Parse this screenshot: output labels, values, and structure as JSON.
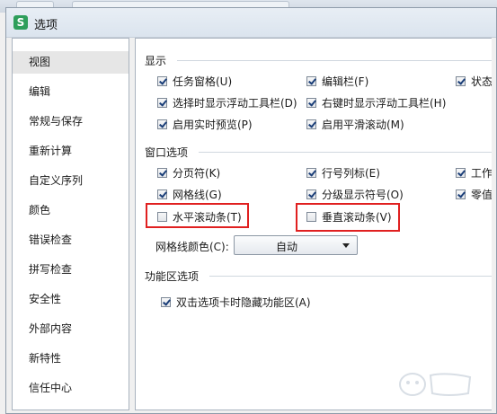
{
  "dialog": {
    "title": "选项",
    "app_icon_letter": "S"
  },
  "sidebar": {
    "items": [
      {
        "label": "视图",
        "selected": true
      },
      {
        "label": "编辑"
      },
      {
        "label": "常规与保存"
      },
      {
        "label": "重新计算"
      },
      {
        "label": "自定义序列"
      },
      {
        "label": "颜色"
      },
      {
        "label": "错误检查"
      },
      {
        "label": "拼写检查"
      },
      {
        "label": "安全性"
      },
      {
        "label": "外部内容"
      },
      {
        "label": "新特性"
      },
      {
        "label": "信任中心"
      }
    ]
  },
  "display": {
    "title": "显示",
    "options": [
      {
        "label": "任务窗格(U)",
        "checked": true
      },
      {
        "label": "编辑栏(F)",
        "checked": true
      },
      {
        "label": "状态栏",
        "checked": true
      },
      {
        "label": "选择时显示浮动工具栏(D)",
        "checked": true
      },
      {
        "label": "右键时显示浮动工具栏(H)",
        "checked": true
      },
      {
        "label": "启用实时预览(P)",
        "checked": true
      },
      {
        "label": "启用平滑滚动(M)",
        "checked": true
      }
    ]
  },
  "window_options": {
    "title": "窗口选项",
    "options": [
      {
        "label": "分页符(K)",
        "checked": true
      },
      {
        "label": "行号列标(E)",
        "checked": true
      },
      {
        "label": "工作表",
        "checked": true
      },
      {
        "label": "网格线(G)",
        "checked": true
      },
      {
        "label": "分级显示符号(O)",
        "checked": true
      },
      {
        "label": "零值(",
        "checked": true
      },
      {
        "label": "水平滚动条(T)",
        "checked": false
      },
      {
        "label": "垂直滚动条(V)",
        "checked": false
      }
    ],
    "grid_color_label": "网格线颜色(C):",
    "grid_color_value": "自动"
  },
  "ribbon": {
    "title": "功能区选项",
    "options": [
      {
        "label": "双击选项卡时隐藏功能区(A)",
        "checked": true
      }
    ]
  },
  "colors": {
    "highlight": "#e02020",
    "accent": "#2e9e5b"
  }
}
